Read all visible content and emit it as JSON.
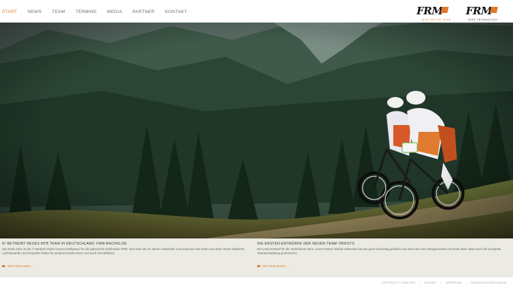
{
  "nav": {
    "items": [
      "START",
      "NEWS",
      "TEAM",
      "TERMINE",
      "MEDIA",
      "PARTNER",
      "KONTAKT"
    ]
  },
  "logos": {
    "left": {
      "wordmark": "FRM",
      "sub": "MTB RACING TEAM"
    },
    "right": {
      "wordmark": "FRM",
      "sub": "BIKE TECHNOLOGY"
    }
  },
  "colors": {
    "accent": "#e07a2e",
    "news_bg": "#ebebe4"
  },
  "news": [
    {
      "title": "R² BETREIBT NEUES MTB TEAM IN DEUTSCHLAND: FRM-RACING.DE",
      "body": "Seit Ende 2011 ist die r² Handels GmbH neuer Distributeur für die italienische Edelmarke FRM. Seit mehr als 20 Jahren entwickelt und produziert das Team aus Riolo Terme etablierte Leichtbauteile und komplette Räder für anspruchsvolle Racer und auch Genußfahrer.",
      "more": "WEITERLESEN ..."
    },
    {
      "title": "DIE ERSTEN ENTWÜRFE DER NEUEN TEAM-TRIKOTS",
      "body": "Der erste Entwurf für die Teamtrikots steht. Unser Partner Biehler Bikewear hat uns ganz kurzfristig geholfen und wird nach den Designmustern bis Ende März dann auch die komplette Teamausstattung produzieren.",
      "more": "WEITERLESEN ..."
    }
  ],
  "footer": [
    "COPYRIGHT © TEAM FRM",
    "KONTAKT",
    "IMPRESSUM",
    "DATENSCHUTZERKLÄRUNG"
  ]
}
